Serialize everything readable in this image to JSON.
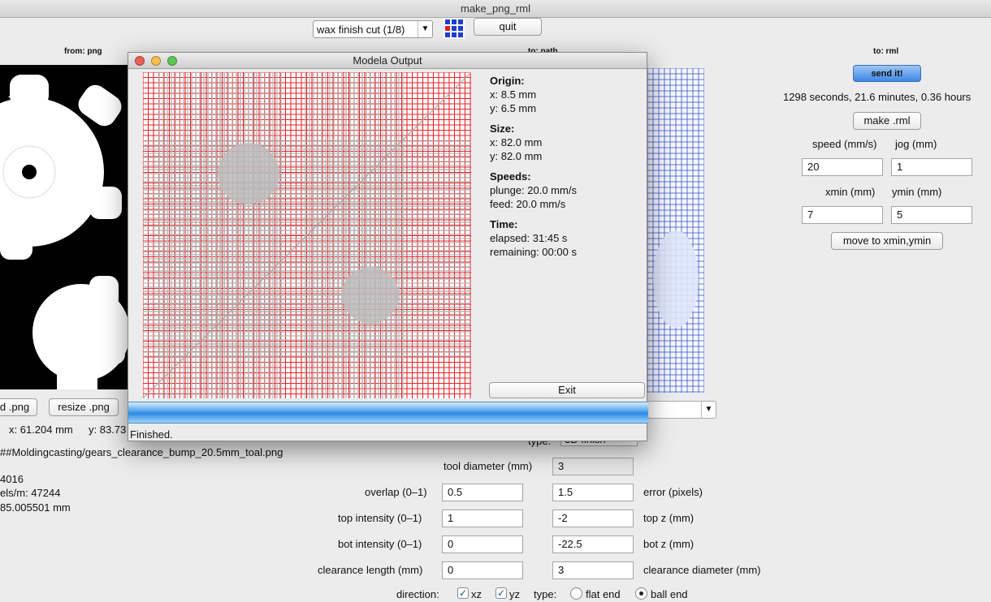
{
  "window": {
    "title": "make_png_rml"
  },
  "toolbar": {
    "process_select": "wax finish cut (1/8)",
    "quit_label": "quit",
    "process_icon": "grid-dots-icon"
  },
  "left": {
    "heading": "from: png",
    "btn_load": "d .png",
    "btn_resize": "resize .png",
    "coords_x": "x: 61.204 mm",
    "coords_y": "y: 83.73",
    "file_path": "##Moldingcasting/gears_clearance_bump_20.5mm_toal.png",
    "info1": "4016",
    "info2": "els/m: 47244",
    "info3": "85.005501 mm"
  },
  "middle": {
    "heading": "to: path"
  },
  "right": {
    "heading": "to: rml",
    "send_label": "send it!",
    "time_text": "1298 seconds, 21.6 minutes, 0.36 hours",
    "make_label": "make .rml",
    "speed_label": "speed (mm/s)",
    "jog_label": "jog (mm)",
    "speed_value": "20",
    "jog_value": "1",
    "xmin_label": "xmin (mm)",
    "ymin_label": "ymin (mm)",
    "xmin_value": "7",
    "ymin_value": "5",
    "move_label": "move to xmin,ymin"
  },
  "path_params": {
    "type_label": "type:",
    "type_value": "3D finish",
    "tool_diameter_label": "tool diameter (mm)",
    "tool_diameter_value": "3",
    "overlap_label": "overlap (0–1)",
    "overlap_value": "0.5",
    "error_value": "1.5",
    "error_label": "error (pixels)",
    "top_intensity_label": "top intensity (0–1)",
    "top_intensity_value": "1",
    "top_z_value": "-2",
    "top_z_label": "top z (mm)",
    "bot_intensity_label": "bot intensity (0–1)",
    "bot_intensity_value": "0",
    "bot_z_value": "-22.5",
    "bot_z_label": "bot z (mm)",
    "clearance_length_label": "clearance length (mm)",
    "clearance_length_value": "0",
    "clearance_diameter_value": "3",
    "clearance_diameter_label": "clearance diameter (mm)",
    "direction_label": "direction:",
    "xz_label": "xz",
    "yz_label": "yz",
    "type2_label": "type:",
    "flat_end_label": "flat end",
    "ball_end_label": "ball end"
  },
  "dialog": {
    "title": "Modela Output",
    "origin_heading": "Origin:",
    "origin_x": "x: 8.5 mm",
    "origin_y": "y: 6.5 mm",
    "size_heading": "Size:",
    "size_x": "x: 82.0 mm",
    "size_y": "y: 82.0 mm",
    "speeds_heading": "Speeds:",
    "plunge": "plunge: 20.0 mm/s",
    "feed": "feed: 20.0 mm/s",
    "time_heading": "Time:",
    "elapsed": "elapsed: 31:45 s",
    "remaining": "remaining: 00:00 s",
    "exit_label": "Exit",
    "status": "Finished.",
    "progress_fraction": 1.0
  },
  "colors": {
    "toolpath_red": "#e8262a",
    "toolpath_blue": "#3450c8",
    "accent_blue": "#3f87e6"
  }
}
